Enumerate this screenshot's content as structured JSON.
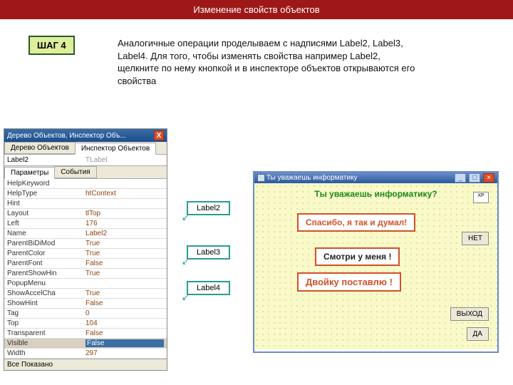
{
  "header": {
    "title": "Изменение свойств объектов"
  },
  "step": {
    "label": "ШАГ 4"
  },
  "intro": {
    "text": "    Аналогичные операции проделываем с надписями Label2, Label3, Label4. Для того, чтобы изменять свойства например Label2, щелкните по нему кнопкой и в инспекторе объектов открываются его свойства"
  },
  "inspector": {
    "title": "Дерево Объектов, Инспектор Объ...",
    "close": "X",
    "tab1": "Дерево Объектов",
    "tab2": "Инспектор Объектов",
    "drop1": "Label2",
    "drop2": "TLabel",
    "tab3": "Параметры",
    "tab4": "События",
    "rows": [
      {
        "k": "HelpKeyword",
        "v": ""
      },
      {
        "k": "HelpType",
        "v": "htContext"
      },
      {
        "k": "Hint",
        "v": ""
      },
      {
        "k": "Layout",
        "v": "tlTop"
      },
      {
        "k": "Left",
        "v": "176"
      },
      {
        "k": "Name",
        "v": "Label2"
      },
      {
        "k": "ParentBiDiMod",
        "v": "True"
      },
      {
        "k": "ParentColor",
        "v": "True"
      },
      {
        "k": "ParentFont",
        "v": "False"
      },
      {
        "k": "ParentShowHin",
        "v": "True"
      },
      {
        "k": "PopupMenu",
        "v": ""
      },
      {
        "k": "ShowAccelCha",
        "v": "True"
      },
      {
        "k": "ShowHint",
        "v": "False"
      },
      {
        "k": "Tag",
        "v": "0"
      },
      {
        "k": "Top",
        "v": "104"
      },
      {
        "k": "Transparent",
        "v": "False"
      },
      {
        "k": "Visible",
        "v": "False",
        "hl": true
      },
      {
        "k": "Width",
        "v": "297"
      }
    ],
    "bottom": "Все Показано"
  },
  "tags": {
    "t1": "Label2",
    "t2": "Label3",
    "t3": "Label4"
  },
  "app": {
    "title": "Ты уважаешь информатику",
    "question": "Ты уважаешь информатику?",
    "l1": "Спасибо, я так и думал!",
    "l2": "Смотри у меня !",
    "l3": "Двойку поставлю !",
    "bn": "НЕТ",
    "bv": "ВЫХОД",
    "bd": "ДА",
    "xp": "XP"
  }
}
